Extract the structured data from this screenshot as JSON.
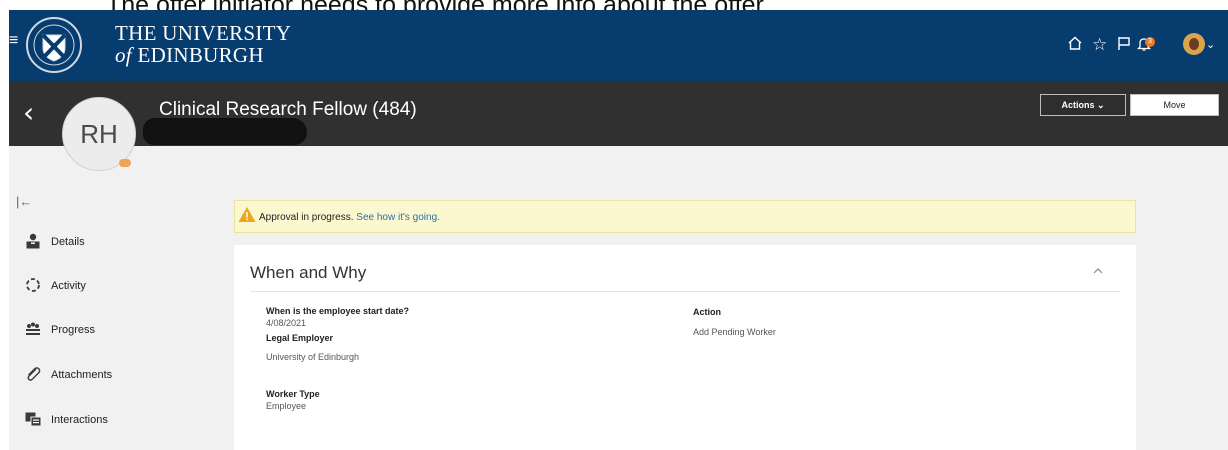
{
  "caption": "The offer initiator needs to provide more info about the offer.",
  "brand": {
    "line1": "THE UNIVERSITY",
    "line2_of": "of",
    "line2_rest": " EDINBURGH"
  },
  "topbar": {
    "icons": [
      "home-icon",
      "star-icon",
      "flag-icon",
      "bell-icon",
      "user-avatar"
    ],
    "notification_count": "3"
  },
  "header": {
    "avatar_initials": "RH",
    "title": "Clinical Research Fellow (484)",
    "actions_label": "Actions",
    "move_label": "Move"
  },
  "nav": {
    "items": [
      {
        "label": "Details",
        "icon": "person-icon"
      },
      {
        "label": "Activity",
        "icon": "activity-icon"
      },
      {
        "label": "Progress",
        "icon": "progress-icon"
      },
      {
        "label": "Attachments",
        "icon": "paperclip-icon"
      },
      {
        "label": "Interactions",
        "icon": "interactions-icon"
      }
    ]
  },
  "banner": {
    "text": "Approval in progress.",
    "link": "See how it's going."
  },
  "card": {
    "title": "When and Why",
    "fields": {
      "start_date_label": "When is the employee start date?",
      "start_date_value": "4/08/2021",
      "legal_employer_label": "Legal Employer",
      "legal_employer_value": "University of Edinburgh",
      "worker_type_label": "Worker Type",
      "worker_type_value": "Employee",
      "action_label": "Action",
      "action_value": "Add Pending Worker"
    }
  },
  "colors": {
    "brand_navy": "#073c6e",
    "header_dark": "#303030",
    "banner_bg": "#fbf8d0",
    "link_blue": "#2e6ea6",
    "warning_orange": "#f0a51a"
  }
}
